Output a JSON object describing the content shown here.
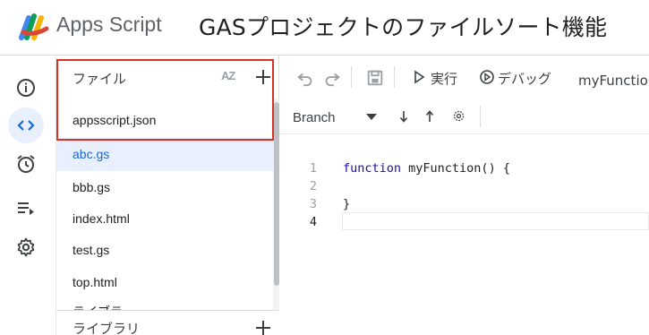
{
  "header": {
    "app_name": "Apps Script",
    "project_title": "GASプロジェクトのファイルソート機能"
  },
  "rail": {
    "items": [
      {
        "icon": "info-icon",
        "active": false
      },
      {
        "icon": "code-icon",
        "active": true
      },
      {
        "icon": "alarm-clock-icon",
        "active": false
      },
      {
        "icon": "executions-icon",
        "active": false
      },
      {
        "icon": "gear-icon",
        "active": false
      }
    ]
  },
  "files": {
    "title": "ファイル",
    "sort_label": "AZ",
    "items": [
      {
        "name": "appsscript.json",
        "selected": false
      },
      {
        "name": "abc.gs",
        "selected": true
      },
      {
        "name": "bbb.gs",
        "selected": false
      },
      {
        "name": "index.html",
        "selected": false
      },
      {
        "name": "test.gs",
        "selected": false
      },
      {
        "name": "top.html",
        "selected": false
      }
    ],
    "partial_item": "ライブラ",
    "libraries_title": "ライブラリ"
  },
  "toolbar": {
    "run_label": "実行",
    "debug_label": "デバッグ",
    "function_select": "myFunction"
  },
  "toolbar2": {
    "branch_label": "Branch"
  },
  "code": {
    "lines": [
      {
        "no": "1",
        "text": "function myFunction() {"
      },
      {
        "no": "2",
        "text": ""
      },
      {
        "no": "3",
        "text": "}"
      },
      {
        "no": "4",
        "text": ""
      }
    ]
  },
  "colors": {
    "accent": "#1967d2",
    "selected_bg": "#e8f0fe",
    "highlight": "#d93025"
  }
}
